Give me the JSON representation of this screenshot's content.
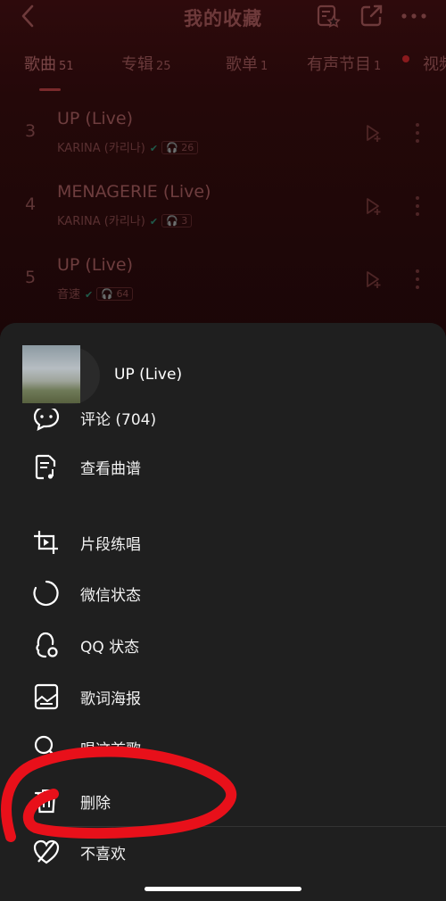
{
  "header": {
    "title": "我的收藏"
  },
  "tabs": [
    {
      "label": "歌曲",
      "count": "51",
      "active": true
    },
    {
      "label": "专辑",
      "count": "25",
      "active": false
    },
    {
      "label": "歌单",
      "count": "1",
      "active": false
    },
    {
      "label": "有声节目",
      "count": "1",
      "active": false
    },
    {
      "label": "视频",
      "count": "",
      "active": false
    }
  ],
  "songs": [
    {
      "index": "3",
      "title": "UP (Live)",
      "artist": "KARINA (카리나)",
      "plays": "26"
    },
    {
      "index": "4",
      "title": "MENAGERIE (Live)",
      "artist": "KARINA (카리나)",
      "plays": "3"
    },
    {
      "index": "5",
      "title": "UP (Live)",
      "artist": "音速",
      "plays": "64"
    }
  ],
  "sheet": {
    "song_name": "UP (Live)",
    "menu": [
      {
        "icon": "comment-icon",
        "label": "评论 (704)"
      },
      {
        "icon": "music-sheet-icon",
        "label": "查看曲谱"
      },
      {
        "icon": "crop-clip-icon",
        "label": "片段练唱"
      },
      {
        "icon": "wechat-status-icon",
        "label": "微信状态"
      },
      {
        "icon": "qq-status-icon",
        "label": "QQ 状态"
      },
      {
        "icon": "lyrics-poster-icon",
        "label": "歌词海报"
      },
      {
        "icon": "search-sing-icon",
        "label": "唱这首歌"
      },
      {
        "icon": "trash-icon",
        "label": "删除"
      },
      {
        "icon": "dislike-heart-icon",
        "label": "不喜欢"
      }
    ]
  },
  "colors": {
    "background": "#0e0304",
    "sheet": "#1f1f1f",
    "annotation": "#e8101a",
    "check": "#1f5a4a"
  }
}
